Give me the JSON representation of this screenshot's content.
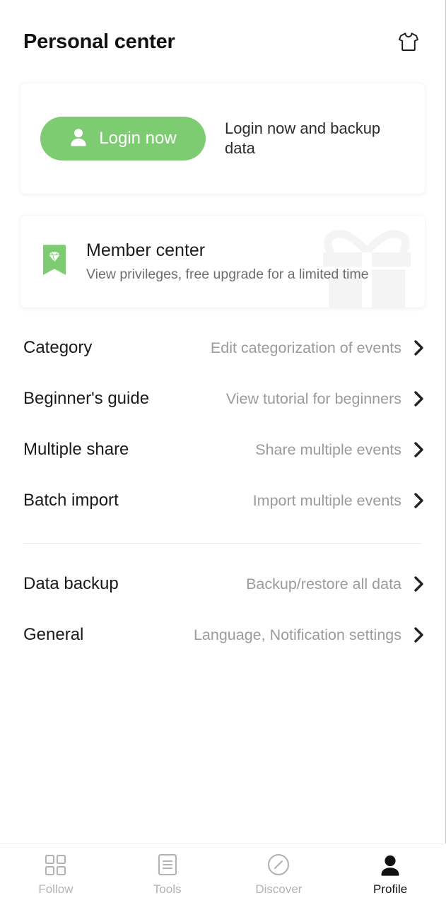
{
  "header": {
    "title": "Personal center",
    "theme_icon": "tshirt-icon"
  },
  "login_card": {
    "button_label": "Login now",
    "button_icon": "person-icon",
    "note": "Login now and backup data",
    "accent_color": "#7ecc71"
  },
  "member_card": {
    "icon": "diamond-badge-icon",
    "title": "Member center",
    "subtitle": "View privileges, free upgrade for a limited time",
    "watermark_icon": "gift-icon"
  },
  "menu": {
    "groups": [
      {
        "items": [
          {
            "label": "Category",
            "value": "Edit categorization of events",
            "chevron": "chevron-right-icon"
          },
          {
            "label": "Beginner's guide",
            "value": "View tutorial for beginners",
            "chevron": "chevron-right-icon"
          },
          {
            "label": "Multiple share",
            "value": "Share multiple events",
            "chevron": "chevron-right-icon"
          },
          {
            "label": "Batch import",
            "value": "Import multiple events",
            "chevron": "chevron-right-icon"
          }
        ]
      },
      {
        "items": [
          {
            "label": "Data backup",
            "value": "Backup/restore all data",
            "chevron": "chevron-right-icon"
          },
          {
            "label": "General",
            "value": "Language, Notification settings",
            "chevron": "chevron-right-icon"
          }
        ]
      }
    ]
  },
  "bottom_nav": {
    "items": [
      {
        "label": "Follow",
        "icon": "grid-icon",
        "active": false
      },
      {
        "label": "Tools",
        "icon": "document-lines-icon",
        "active": false
      },
      {
        "label": "Discover",
        "icon": "compass-icon",
        "active": false
      },
      {
        "label": "Profile",
        "icon": "person-filled-icon",
        "active": true
      }
    ]
  }
}
